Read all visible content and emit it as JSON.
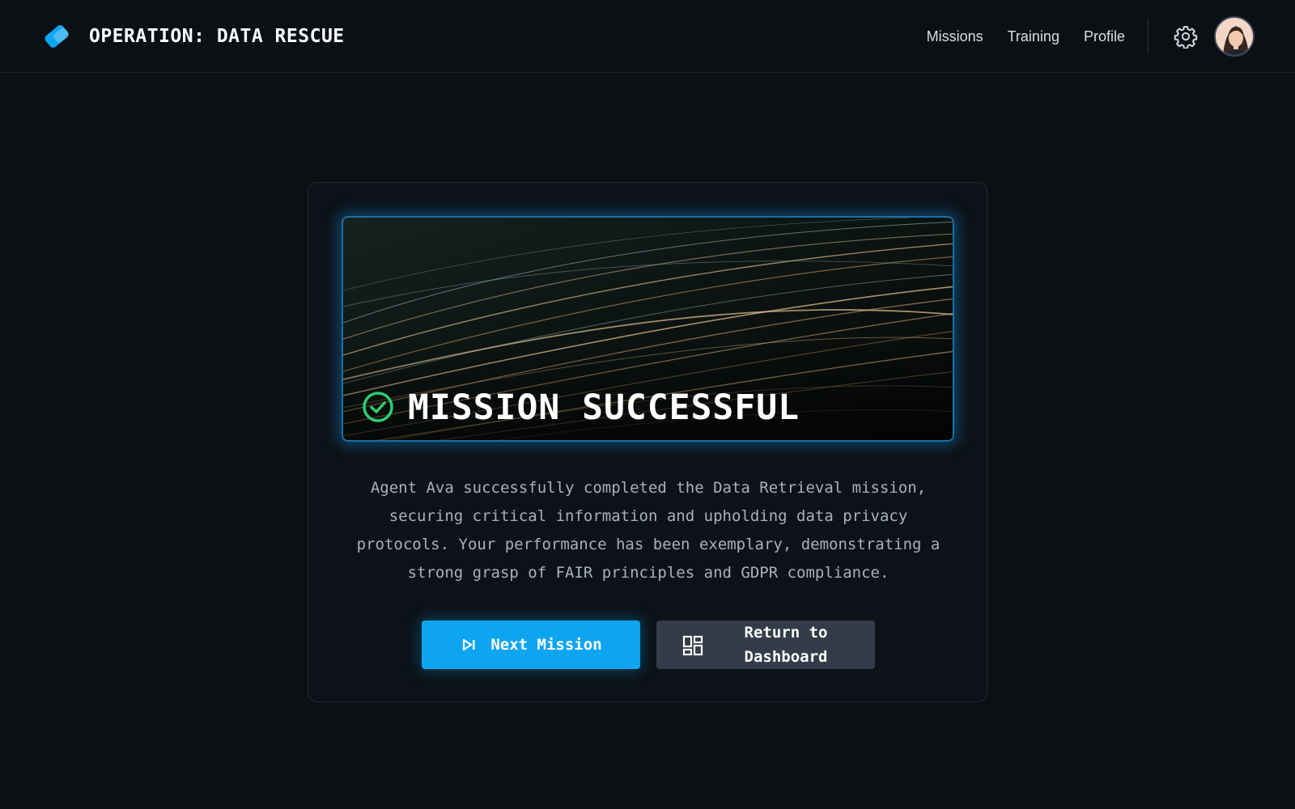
{
  "header": {
    "title": "OPERATION: DATA RESCUE",
    "logo_icon": "blue-tag-icon",
    "nav": [
      {
        "label": "Missions"
      },
      {
        "label": "Training"
      },
      {
        "label": "Profile"
      }
    ],
    "settings_icon": "gear-icon",
    "avatar": "user-avatar"
  },
  "card": {
    "hero_title": "MISSION SUCCESSFUL",
    "hero_icon": "check-circle-icon",
    "description": "Agent Ava successfully completed the Data Retrieval mission, securing critical information and upholding data privacy protocols. Your performance has been exemplary, demonstrating a strong grasp of FAIR principles and GDPR compliance.",
    "primary_button": {
      "label": "Next Mission",
      "icon": "skip-next-icon"
    },
    "secondary_button": {
      "label": "Return to Dashboard",
      "icon": "dashboard-icon"
    }
  },
  "colors": {
    "background": "#0b1015",
    "accent": "#0ea5f0",
    "success": "#2ecc71",
    "secondary_button": "#343c49"
  }
}
